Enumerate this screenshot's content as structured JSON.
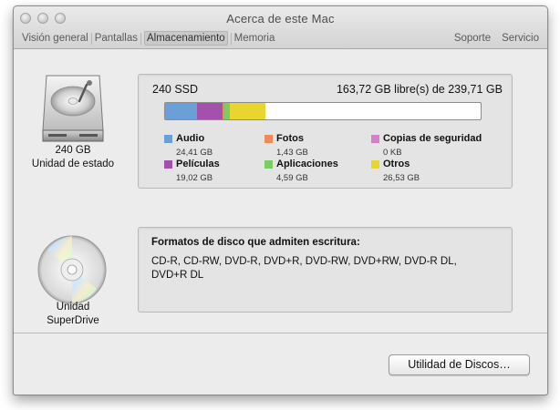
{
  "window": {
    "title": "Acerca de este Mac",
    "tabs": [
      "Visión general",
      "Pantallas",
      "Almacenamiento",
      "Memoria"
    ],
    "active_tab": "Almacenamiento",
    "right_tabs": [
      "Soporte",
      "Servicio"
    ]
  },
  "ssd": {
    "icon": "hard-drive-icon",
    "label_line1": "240 GB",
    "label_line2": "Unidad de estado",
    "name": "240 SSD",
    "free": "163,72 GB libre(s) de 239,71 GB",
    "usage_bar": [
      {
        "category": "Audio",
        "gb": 24.41,
        "color": "#6a9fd8"
      },
      {
        "category": "Películas",
        "gb": 19.02,
        "color": "#a351ad"
      },
      {
        "category": "Fotos",
        "gb": 1.43,
        "color": "#ef8a5c"
      },
      {
        "category": "Aplicaciones",
        "gb": 4.59,
        "color": "#7ccc66"
      },
      {
        "category": "Otros",
        "gb": 26.53,
        "color": "#e8d62e"
      }
    ],
    "total_gb": 239.71,
    "legend": [
      {
        "name": "Audio",
        "size": "24,41 GB",
        "color": "#6a9fd8"
      },
      {
        "name": "Películas",
        "size": "19,02 GB",
        "color": "#a351ad"
      },
      {
        "name": "Fotos",
        "size": "1,43 GB",
        "color": "#ef8a5c"
      },
      {
        "name": "Aplicaciones",
        "size": "4,59 GB",
        "color": "#7ccc66"
      },
      {
        "name": "Copias de seguridad",
        "size": "0 KB",
        "color": "#d67fc7"
      },
      {
        "name": "Otros",
        "size": "26,53 GB",
        "color": "#e8d62e"
      }
    ]
  },
  "superdrive": {
    "icon": "optical-disc-icon",
    "label_line1": "Unidad",
    "label_line2": "SuperDrive",
    "formats_title": "Formatos de disco que admiten escritura:",
    "formats": "CD-R, CD-RW, DVD-R, DVD+R, DVD-RW, DVD+RW, DVD-R DL, DVD+R DL"
  },
  "button": {
    "label": "Utilidad de Discos…"
  }
}
